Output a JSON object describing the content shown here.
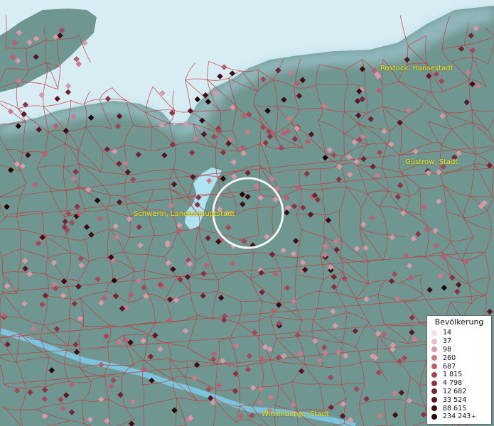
{
  "map": {
    "colors": {
      "land": "#6f9690",
      "sea": "#d7ecf3",
      "borders": "#c43a3a",
      "labels": "#e8e23a",
      "focus_ring": "#ffffff"
    },
    "cities": [
      {
        "name": "Rostock, Hansestadt"
      },
      {
        "name": "Güstrow, Stadt"
      },
      {
        "name": "Schwerin, Landeshauptstadt"
      },
      {
        "name": "Wittenberge, Stadt"
      }
    ]
  },
  "legend": {
    "title": "Bevölkerung",
    "plus_mark": "+",
    "items": [
      {
        "label": "14",
        "color": "#f6dde3"
      },
      {
        "label": "37",
        "color": "#ebbcc6"
      },
      {
        "label": "98",
        "color": "#d99aa7"
      },
      {
        "label": "260",
        "color": "#c97c8b"
      },
      {
        "label": "687",
        "color": "#b86072"
      },
      {
        "label": "1 815",
        "color": "#a3475a"
      },
      {
        "label": "4 798",
        "color": "#8c3345"
      },
      {
        "label": "12 682",
        "color": "#742334"
      },
      {
        "label": "33 524",
        "color": "#5a1624"
      },
      {
        "label": "88 615",
        "color": "#3f0c16"
      },
      {
        "label": "234 243",
        "color": "#22040a"
      }
    ]
  }
}
